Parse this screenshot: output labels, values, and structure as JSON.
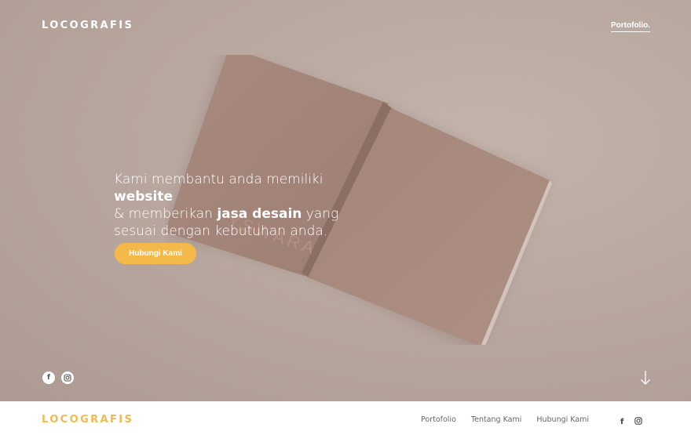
{
  "header": {
    "logo": "LOCOGRAFIS",
    "portfolio_link": "Portofolio."
  },
  "hero": {
    "headline_1": "Kami membantu anda memiliki ",
    "headline_bold_1": "website",
    "headline_2": "& memberikan ",
    "headline_bold_2": "jasa desain",
    "headline_3": " yang sesuai dengan kebutuhan anda.",
    "cta_label": "Hubungi Kami",
    "book_brand": "YSWARA",
    "social_icons": [
      "facebook-icon",
      "instagram-icon"
    ]
  },
  "footer": {
    "logo": "LOCOGRAFIS",
    "nav": [
      "Portofolio",
      "Tentang Kami",
      "Hubungi Kami"
    ],
    "social_icons": [
      "facebook-icon",
      "instagram-icon"
    ]
  },
  "colors": {
    "hero_bg": "#b9a8a0",
    "accent": "#f5b94a",
    "book": "#a6887c"
  }
}
